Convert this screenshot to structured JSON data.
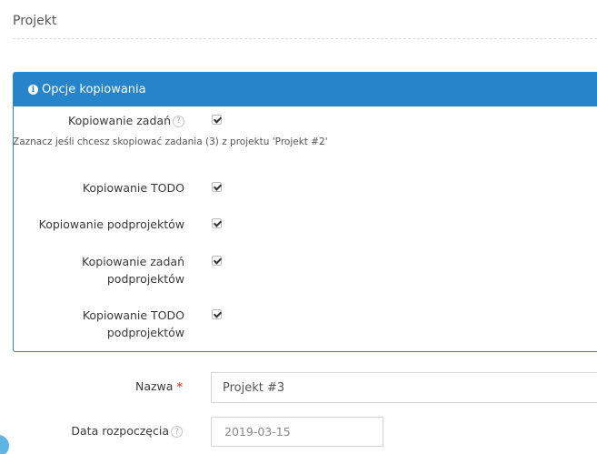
{
  "section": {
    "title": "Projekt"
  },
  "panel": {
    "header_label": "Opcje kopiowania",
    "header_icon": "info-icon",
    "accent_color": "#2684cb",
    "options": [
      {
        "label": "Kopiowanie zadań",
        "checked": true,
        "has_help": true
      },
      {
        "label": "Kopiowanie TODO",
        "checked": true,
        "has_help": false
      },
      {
        "label": "Kopiowanie podprojektów",
        "checked": true,
        "has_help": false
      },
      {
        "label_line1": "Kopiowanie zadań",
        "label_line2": "podprojektów",
        "checked": true,
        "has_help": false
      },
      {
        "label_line1": "Kopiowanie TODO",
        "label_line2": "podprojektów",
        "checked": true,
        "has_help": false
      }
    ],
    "hint": "Zaznacz jeśli chcesz skopiować zadania (3) z projektu 'Projekt #2'"
  },
  "form": {
    "name_label": "Nazwa",
    "required_mark": "*",
    "name_value": "Projekt #3",
    "start_date_label": "Data rozpoczęcia",
    "start_date_value": "2019-03-15"
  },
  "help_glyph": "?",
  "info_glyph": "i"
}
